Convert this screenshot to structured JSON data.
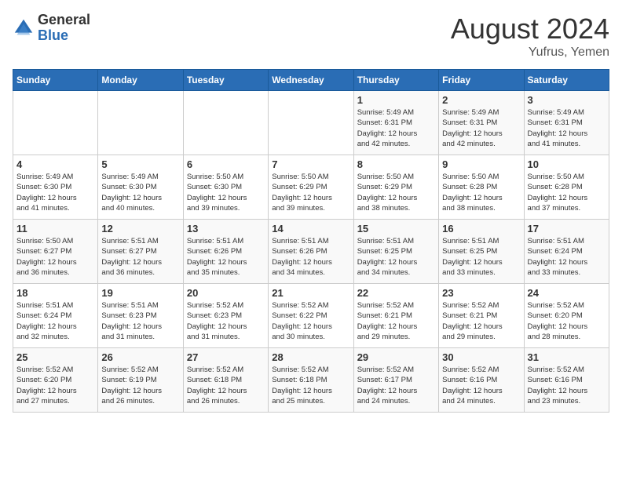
{
  "header": {
    "logo_general": "General",
    "logo_blue": "Blue",
    "month_title": "August 2024",
    "subtitle": "Yufrus, Yemen"
  },
  "days_of_week": [
    "Sunday",
    "Monday",
    "Tuesday",
    "Wednesday",
    "Thursday",
    "Friday",
    "Saturday"
  ],
  "weeks": [
    [
      {
        "day": "",
        "info": ""
      },
      {
        "day": "",
        "info": ""
      },
      {
        "day": "",
        "info": ""
      },
      {
        "day": "",
        "info": ""
      },
      {
        "day": "1",
        "info": "Sunrise: 5:49 AM\nSunset: 6:31 PM\nDaylight: 12 hours\nand 42 minutes."
      },
      {
        "day": "2",
        "info": "Sunrise: 5:49 AM\nSunset: 6:31 PM\nDaylight: 12 hours\nand 42 minutes."
      },
      {
        "day": "3",
        "info": "Sunrise: 5:49 AM\nSunset: 6:31 PM\nDaylight: 12 hours\nand 41 minutes."
      }
    ],
    [
      {
        "day": "4",
        "info": "Sunrise: 5:49 AM\nSunset: 6:30 PM\nDaylight: 12 hours\nand 41 minutes."
      },
      {
        "day": "5",
        "info": "Sunrise: 5:49 AM\nSunset: 6:30 PM\nDaylight: 12 hours\nand 40 minutes."
      },
      {
        "day": "6",
        "info": "Sunrise: 5:50 AM\nSunset: 6:30 PM\nDaylight: 12 hours\nand 39 minutes."
      },
      {
        "day": "7",
        "info": "Sunrise: 5:50 AM\nSunset: 6:29 PM\nDaylight: 12 hours\nand 39 minutes."
      },
      {
        "day": "8",
        "info": "Sunrise: 5:50 AM\nSunset: 6:29 PM\nDaylight: 12 hours\nand 38 minutes."
      },
      {
        "day": "9",
        "info": "Sunrise: 5:50 AM\nSunset: 6:28 PM\nDaylight: 12 hours\nand 38 minutes."
      },
      {
        "day": "10",
        "info": "Sunrise: 5:50 AM\nSunset: 6:28 PM\nDaylight: 12 hours\nand 37 minutes."
      }
    ],
    [
      {
        "day": "11",
        "info": "Sunrise: 5:50 AM\nSunset: 6:27 PM\nDaylight: 12 hours\nand 36 minutes."
      },
      {
        "day": "12",
        "info": "Sunrise: 5:51 AM\nSunset: 6:27 PM\nDaylight: 12 hours\nand 36 minutes."
      },
      {
        "day": "13",
        "info": "Sunrise: 5:51 AM\nSunset: 6:26 PM\nDaylight: 12 hours\nand 35 minutes."
      },
      {
        "day": "14",
        "info": "Sunrise: 5:51 AM\nSunset: 6:26 PM\nDaylight: 12 hours\nand 34 minutes."
      },
      {
        "day": "15",
        "info": "Sunrise: 5:51 AM\nSunset: 6:25 PM\nDaylight: 12 hours\nand 34 minutes."
      },
      {
        "day": "16",
        "info": "Sunrise: 5:51 AM\nSunset: 6:25 PM\nDaylight: 12 hours\nand 33 minutes."
      },
      {
        "day": "17",
        "info": "Sunrise: 5:51 AM\nSunset: 6:24 PM\nDaylight: 12 hours\nand 33 minutes."
      }
    ],
    [
      {
        "day": "18",
        "info": "Sunrise: 5:51 AM\nSunset: 6:24 PM\nDaylight: 12 hours\nand 32 minutes."
      },
      {
        "day": "19",
        "info": "Sunrise: 5:51 AM\nSunset: 6:23 PM\nDaylight: 12 hours\nand 31 minutes."
      },
      {
        "day": "20",
        "info": "Sunrise: 5:52 AM\nSunset: 6:23 PM\nDaylight: 12 hours\nand 31 minutes."
      },
      {
        "day": "21",
        "info": "Sunrise: 5:52 AM\nSunset: 6:22 PM\nDaylight: 12 hours\nand 30 minutes."
      },
      {
        "day": "22",
        "info": "Sunrise: 5:52 AM\nSunset: 6:21 PM\nDaylight: 12 hours\nand 29 minutes."
      },
      {
        "day": "23",
        "info": "Sunrise: 5:52 AM\nSunset: 6:21 PM\nDaylight: 12 hours\nand 29 minutes."
      },
      {
        "day": "24",
        "info": "Sunrise: 5:52 AM\nSunset: 6:20 PM\nDaylight: 12 hours\nand 28 minutes."
      }
    ],
    [
      {
        "day": "25",
        "info": "Sunrise: 5:52 AM\nSunset: 6:20 PM\nDaylight: 12 hours\nand 27 minutes."
      },
      {
        "day": "26",
        "info": "Sunrise: 5:52 AM\nSunset: 6:19 PM\nDaylight: 12 hours\nand 26 minutes."
      },
      {
        "day": "27",
        "info": "Sunrise: 5:52 AM\nSunset: 6:18 PM\nDaylight: 12 hours\nand 26 minutes."
      },
      {
        "day": "28",
        "info": "Sunrise: 5:52 AM\nSunset: 6:18 PM\nDaylight: 12 hours\nand 25 minutes."
      },
      {
        "day": "29",
        "info": "Sunrise: 5:52 AM\nSunset: 6:17 PM\nDaylight: 12 hours\nand 24 minutes."
      },
      {
        "day": "30",
        "info": "Sunrise: 5:52 AM\nSunset: 6:16 PM\nDaylight: 12 hours\nand 24 minutes."
      },
      {
        "day": "31",
        "info": "Sunrise: 5:52 AM\nSunset: 6:16 PM\nDaylight: 12 hours\nand 23 minutes."
      }
    ]
  ]
}
